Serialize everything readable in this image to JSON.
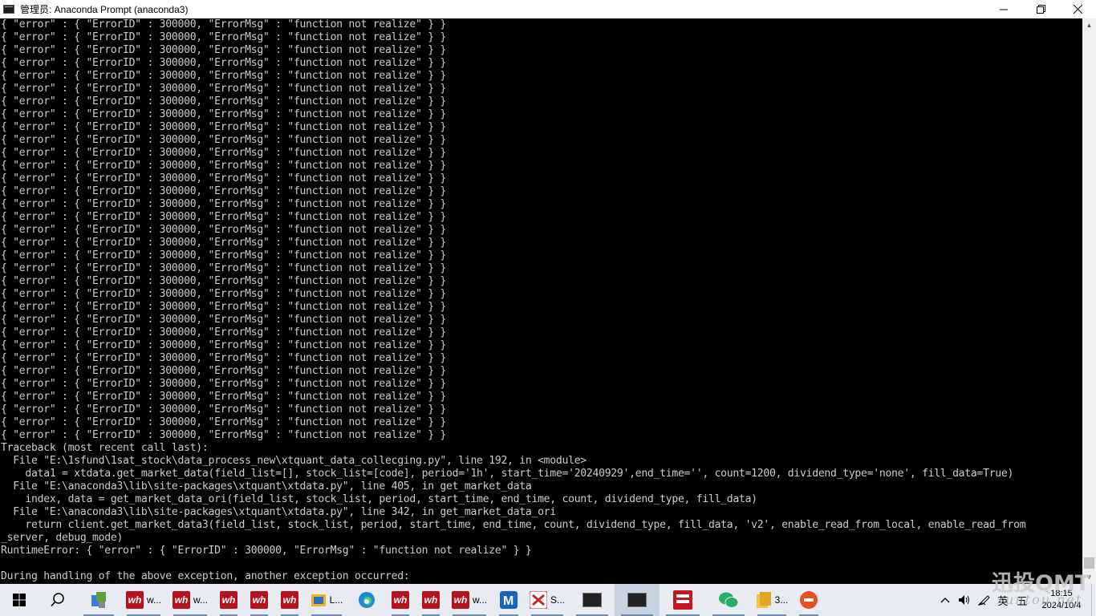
{
  "window": {
    "title": "管理员: Anaconda Prompt (anaconda3)"
  },
  "console": {
    "error_line": "{ \"error\" : { \"ErrorID\" : 300000, \"ErrorMsg\" : \"function not realize\" } }",
    "error_line_count": 33,
    "traceback": [
      "Traceback (most recent call last):",
      "  File \"E:\\1sfund\\1sat_stock\\data_process_new\\xtquant_data_collecging.py\", line 192, in <module>",
      "    data1 = xtdata.get_market_data(field_list=[], stock_list=[code], period='1h', start_time='20240929',end_time='', count=1200, dividend_type='none', fill_data=True)",
      "  File \"E:\\anaconda3\\lib\\site-packages\\xtquant\\xtdata.py\", line 405, in get_market_data",
      "    index, data = get_market_data_ori(field_list, stock_list, period, start_time, end_time, count, dividend_type, fill_data)",
      "  File \"E:\\anaconda3\\lib\\site-packages\\xtquant\\xtdata.py\", line 342, in get_market_data_ori",
      "    return client.get_market_data3(field_list, stock_list, period, start_time, end_time, count, dividend_type, fill_data, 'v2', enable_read_from_local, enable_read_from",
      "_server, debug_mode)",
      "RuntimeError: { \"error\" : { \"ErrorID\" : 300000, \"ErrorMsg\" : \"function not realize\" } }",
      "",
      "During handling of the above exception, another exception occurred:"
    ]
  },
  "taskbar": {
    "items": [
      {
        "name": "wh-app-1",
        "label": "w..."
      },
      {
        "name": "wh-app-2",
        "label": "w..."
      },
      {
        "name": "wh-app-6",
        "label": "w..."
      },
      {
        "name": "folder-app",
        "label": "L..."
      },
      {
        "name": "sublime-app",
        "label": "S..."
      },
      {
        "name": "explorer-3",
        "label": "3..."
      }
    ],
    "tray_ime": "英",
    "tray_ime2": "五",
    "clock_time": "18:15",
    "clock_date": "2024/10/4"
  },
  "watermark": {
    "main": "迅投QMT",
    "sub": "xuntou.net"
  },
  "colors": {
    "console_bg": "#000000",
    "console_fg": "#cccccc",
    "taskbar_bg": "#e8ecf2"
  }
}
